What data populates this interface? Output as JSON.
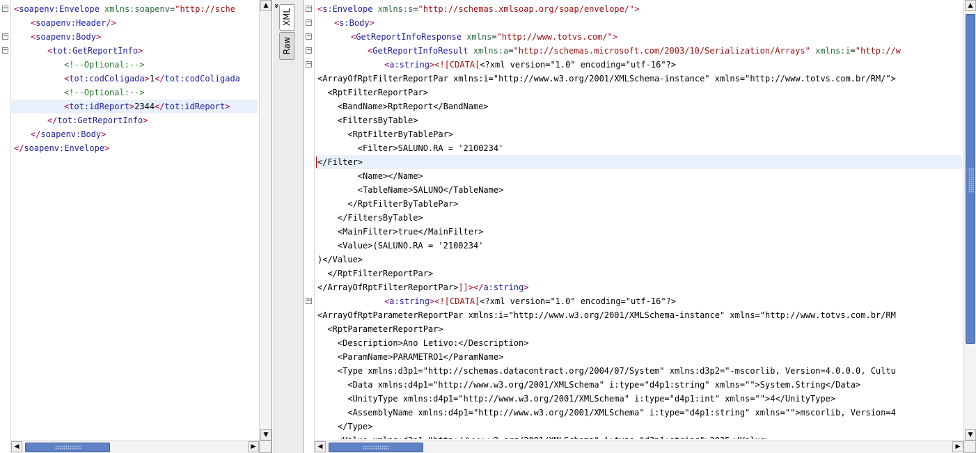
{
  "left_pane": {
    "lines": [
      {
        "fold": "minus",
        "indent": 0,
        "html": "<span class='tag'>&lt;</span><span class='tn'>soapenv:Envelope</span> <span class='an'>xmlns:soapenv</span>=<span class='av'>\"http://sche</span>"
      },
      {
        "fold": "",
        "indent": 1,
        "html": "<span class='tag'>&lt;</span><span class='tn'>soapenv:Header</span><span class='tag'>/&gt;</span>"
      },
      {
        "fold": "minus",
        "indent": 1,
        "html": "<span class='tag'>&lt;</span><span class='tn'>soapenv:Body</span><span class='tag'>&gt;</span>"
      },
      {
        "fold": "minus",
        "indent": 2,
        "html": "<span class='tag'>&lt;</span><span class='tn'>tot:GetReportInfo</span><span class='tag'>&gt;</span>"
      },
      {
        "fold": "",
        "indent": 3,
        "html": "<span class='cmt'>&lt;!--Optional:--&gt;</span>"
      },
      {
        "fold": "",
        "indent": 3,
        "html": "<span class='tag'>&lt;</span><span class='tn'>tot:codColigada</span><span class='tag'>&gt;</span><span class='txt'>1</span><span class='tag'>&lt;/</span><span class='tn'>tot:codColigada</span>"
      },
      {
        "fold": "",
        "indent": 3,
        "html": "<span class='cmt'>&lt;!--Optional:--&gt;</span>"
      },
      {
        "fold": "",
        "indent": 3,
        "hl": true,
        "html": "<span class='tag'>&lt;</span><span class='tn'>tot:idReport</span><span class='tag'>&gt;</span><span class='txt'>2344</span><span class='tag'>&lt;/</span><span class='tn'>tot:idReport</span><span class='tag'>&gt;</span>"
      },
      {
        "fold": "",
        "indent": 2,
        "html": "<span class='tag'>&lt;/</span><span class='tn'>tot:GetReportInfo</span><span class='tag'>&gt;</span>"
      },
      {
        "fold": "",
        "indent": 1,
        "html": "<span class='tag'>&lt;/</span><span class='tn'>soapenv:Body</span><span class='tag'>&gt;</span>"
      },
      {
        "fold": "",
        "indent": 0,
        "html": "<span class='tag'>&lt;/</span><span class='tn'>soapenv:Envelope</span><span class='tag'>&gt;</span>"
      }
    ]
  },
  "side_tabs": {
    "xml_label": "XML",
    "raw_label": "Raw",
    "collapse_glyph": "»"
  },
  "right_pane": {
    "lines": [
      {
        "fold": "minus",
        "indent": 0,
        "html": "<span class='tag'>&lt;</span><span class='tn'>s:Envelope</span> <span class='an'>xmlns:s</span>=<span class='av'>\"http://schemas.xmlsoap.org/soap/envelope/\"</span><span class='tag'>&gt;</span>"
      },
      {
        "fold": "minus",
        "indent": 1,
        "html": "<span class='tag'>&lt;</span><span class='tn'>s:Body</span><span class='tag'>&gt;</span>"
      },
      {
        "fold": "minus",
        "indent": 2,
        "html": "<span class='tag'>&lt;</span><span class='tn'>GetReportInfoResponse</span> <span class='an'>xmlns</span>=<span class='av'>\"http://www.totvs.com/\"</span><span class='tag'>&gt;</span>"
      },
      {
        "fold": "minus",
        "indent": 3,
        "html": "<span class='tag'>&lt;</span><span class='tn'>GetReportInfoResult</span> <span class='an'>xmlns:a</span>=<span class='av'>\"http://schemas.microsoft.com/2003/10/Serialization/Arrays\"</span> <span class='an'>xmlns:i</span>=<span class='av'>\"http://w</span>"
      },
      {
        "fold": "minus",
        "indent": 4,
        "html": "<span class='tag'>&lt;</span><span class='tn'>a:string</span><span class='tag'>&gt;</span><span class='cdata'>&lt;![CDATA[</span><span class='txt'>&lt;?xml version=\"1.0\" encoding=\"utf-16\"?&gt;</span>"
      },
      {
        "fold": "",
        "indent": 0,
        "raw": true,
        "html": "<span class='txt'>&lt;ArrayOfRptFilterReportPar xmlns:i=\"http://www.w3.org/2001/XMLSchema-instance\" xmlns=\"http://www.totvs.com.br/RM/\"&gt;</span>"
      },
      {
        "fold": "",
        "indent": 0,
        "raw": true,
        "html": "<span class='txt'>  &lt;RptFilterReportPar&gt;</span>"
      },
      {
        "fold": "",
        "indent": 0,
        "raw": true,
        "html": "<span class='txt'>    &lt;BandName&gt;RptReport&lt;/BandName&gt;</span>"
      },
      {
        "fold": "",
        "indent": 0,
        "raw": true,
        "html": "<span class='txt'>    &lt;FiltersByTable&gt;</span>"
      },
      {
        "fold": "",
        "indent": 0,
        "raw": true,
        "html": "<span class='txt'>      &lt;RptFilterByTablePar&gt;</span>"
      },
      {
        "fold": "",
        "indent": 0,
        "raw": true,
        "html": "<span class='txt'>        &lt;Filter&gt;SALUNO.RA = '2100234'</span>"
      },
      {
        "fold": "",
        "indent": 0,
        "raw": true,
        "hl": true,
        "caret": true,
        "html": "<span class='txt'>&lt;/Filter&gt;</span>"
      },
      {
        "fold": "",
        "indent": 0,
        "raw": true,
        "html": "<span class='txt'>        &lt;Name&gt;&lt;/Name&gt;</span>"
      },
      {
        "fold": "",
        "indent": 0,
        "raw": true,
        "html": "<span class='txt'>        &lt;TableName&gt;SALUNO&lt;/TableName&gt;</span>"
      },
      {
        "fold": "",
        "indent": 0,
        "raw": true,
        "html": "<span class='txt'>      &lt;/RptFilterByTablePar&gt;</span>"
      },
      {
        "fold": "",
        "indent": 0,
        "raw": true,
        "html": "<span class='txt'>    &lt;/FiltersByTable&gt;</span>"
      },
      {
        "fold": "",
        "indent": 0,
        "raw": true,
        "html": "<span class='txt'>    &lt;MainFilter&gt;true&lt;/MainFilter&gt;</span>"
      },
      {
        "fold": "",
        "indent": 0,
        "raw": true,
        "html": "<span class='txt'>    &lt;Value&gt;(SALUNO.RA = '2100234'</span>"
      },
      {
        "fold": "",
        "indent": 0,
        "raw": true,
        "html": "<span class='txt'>)&lt;/Value&gt;</span>"
      },
      {
        "fold": "",
        "indent": 0,
        "raw": true,
        "html": "<span class='txt'>  &lt;/RptFilterReportPar&gt;</span>"
      },
      {
        "fold": "",
        "indent": 0,
        "raw": true,
        "html": "<span class='txt'>&lt;/ArrayOfRptFilterReportPar&gt;</span><span class='cdata'>]]&gt;</span><span class='tag'>&lt;/</span><span class='tn'>a:string</span><span class='tag'>&gt;</span>"
      },
      {
        "fold": "minus",
        "indent": 4,
        "html": "<span class='tag'>&lt;</span><span class='tn'>a:string</span><span class='tag'>&gt;</span><span class='cdata'>&lt;![CDATA[</span><span class='txt'>&lt;?xml version=\"1.0\" encoding=\"utf-16\"?&gt;</span>"
      },
      {
        "fold": "",
        "indent": 0,
        "raw": true,
        "html": "<span class='txt'>&lt;ArrayOfRptParameterReportPar xmlns:i=\"http://www.w3.org/2001/XMLSchema-instance\" xmlns=\"http://www.totvs.com.br/RM</span>"
      },
      {
        "fold": "",
        "indent": 0,
        "raw": true,
        "html": "<span class='txt'>  &lt;RptParameterReportPar&gt;</span>"
      },
      {
        "fold": "",
        "indent": 0,
        "raw": true,
        "html": "<span class='txt'>    &lt;Description&gt;Ano Letivo:&lt;/Description&gt;</span>"
      },
      {
        "fold": "",
        "indent": 0,
        "raw": true,
        "html": "<span class='txt'>    &lt;ParamName&gt;PARAMETRO1&lt;/ParamName&gt;</span>"
      },
      {
        "fold": "",
        "indent": 0,
        "raw": true,
        "html": "<span class='txt'>    &lt;Type xmlns:d3p1=\"http://schemas.datacontract.org/2004/07/System\" xmlns:d3p2=\"-mscorlib, Version=4.0.0.0, Cultu</span>"
      },
      {
        "fold": "",
        "indent": 0,
        "raw": true,
        "html": "<span class='txt'>      &lt;Data xmlns:d4p1=\"http://www.w3.org/2001/XMLSchema\" i:type=\"d4p1:string\" xmlns=\"\"&gt;System.String&lt;/Data&gt;</span>"
      },
      {
        "fold": "",
        "indent": 0,
        "raw": true,
        "html": "<span class='txt'>      &lt;UnityType xmlns:d4p1=\"http://www.w3.org/2001/XMLSchema\" i:type=\"d4p1:int\" xmlns=\"\"&gt;4&lt;/UnityType&gt;</span>"
      },
      {
        "fold": "",
        "indent": 0,
        "raw": true,
        "html": "<span class='txt'>      &lt;AssemblyName xmlns:d4p1=\"http://www.w3.org/2001/XMLSchema\" i:type=\"d4p1:string\" xmlns=\"\"&gt;mscorlib, Version=4</span>"
      },
      {
        "fold": "",
        "indent": 0,
        "raw": true,
        "html": "<span class='txt'>    &lt;/Type&gt;</span>"
      },
      {
        "fold": "",
        "indent": 0,
        "raw": true,
        "html": "<span class='txt'>    &lt;Value xmlns:d3p1=\"http://www.w3.org/2001/XMLSchema\" i:type=\"d3p1:string\"&gt;2025&lt;/Value&gt;</span>"
      }
    ]
  },
  "scrollbars": {
    "left_v_up": "▲",
    "left_v_down": "▼",
    "left_h_left": "◀",
    "left_h_right": "▶",
    "right_v_up": "▲",
    "right_v_down": "▼",
    "right_h_left": "◀",
    "right_h_right": "▶"
  }
}
